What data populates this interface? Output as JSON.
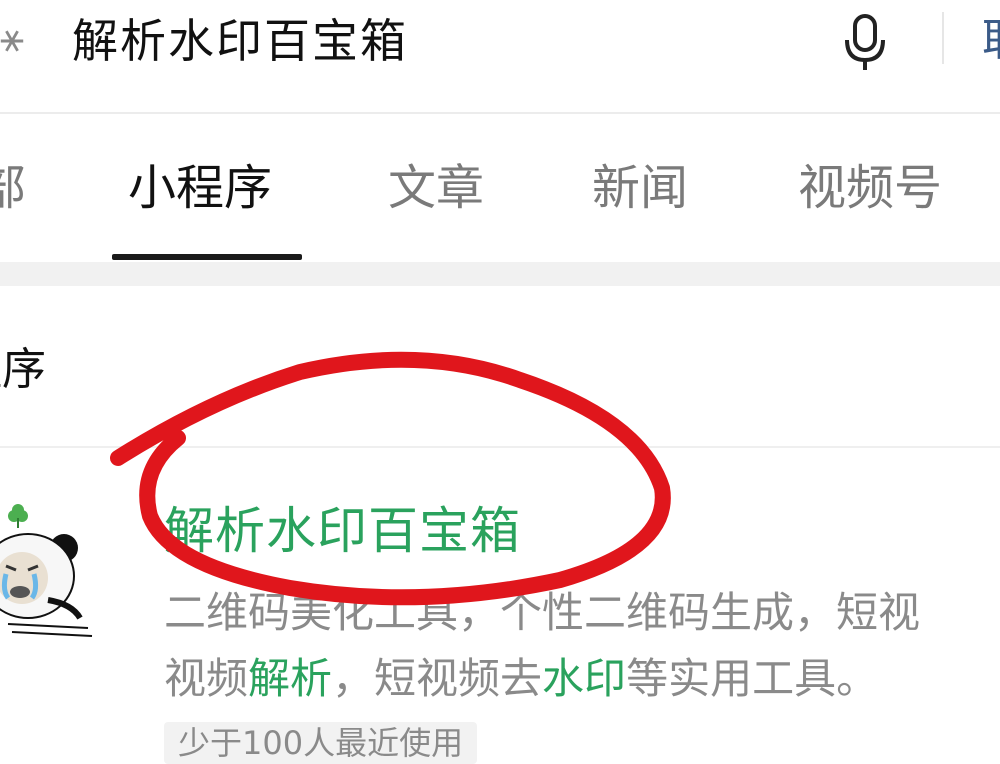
{
  "search": {
    "query": "解析水印百宝箱",
    "cancel_label": "取"
  },
  "tabs": [
    {
      "label": "部"
    },
    {
      "label": "小程序"
    },
    {
      "label": "文章"
    },
    {
      "label": "新闻"
    },
    {
      "label": "视频号"
    }
  ],
  "active_tab_index": 1,
  "section": {
    "title": "程序"
  },
  "result": {
    "title": "解析水印百宝箱",
    "desc_line1": "二维码美化工具，个性二维码生成，短视",
    "desc_line2_parts": [
      "视频",
      "解析",
      "，短视频去",
      "水印",
      "等实用工具。"
    ],
    "usage_badge": "少于100人最近使用"
  },
  "icons": {
    "search": "search-icon",
    "mic": "microphone-icon",
    "avatar": "panda-meme-avatar"
  },
  "colors": {
    "accent_green": "#2aa25d",
    "annotation_red": "#e0161c",
    "link_blue": "#3b5b88"
  }
}
